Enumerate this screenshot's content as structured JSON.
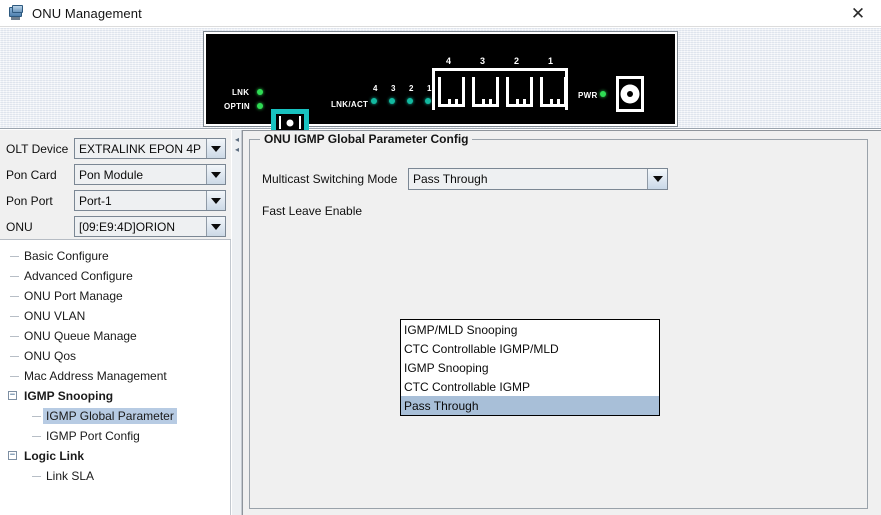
{
  "window": {
    "title": "ONU Management",
    "icon": "computer-monitor-icon",
    "close_label": "✕"
  },
  "device_panel": {
    "lnk_label": "LNK",
    "optin_label": "OPTIN",
    "lnkact_label": "LNK/ACT",
    "pwr_label": "PWR",
    "lnkact_numbers": [
      "4",
      "3",
      "2",
      "1"
    ],
    "port_numbers": [
      "4",
      "3",
      "2",
      "1"
    ],
    "led_green": "#2fdc54",
    "led_teal": "#13b9a0",
    "connector_color": "#18c2c0"
  },
  "selectors": [
    {
      "label": "OLT Device",
      "value": "EXTRALINK EPON 4P"
    },
    {
      "label": "Pon Card",
      "value": "Pon Module"
    },
    {
      "label": "Pon Port",
      "value": "Port-1"
    },
    {
      "label": "ONU",
      "value": "[09:E9:4D]ORION"
    }
  ],
  "tree": {
    "items": [
      {
        "label": "Basic Configure",
        "level": 1,
        "bold": false,
        "selected": false,
        "expander": null
      },
      {
        "label": "Advanced Configure",
        "level": 1,
        "bold": false,
        "selected": false,
        "expander": null
      },
      {
        "label": "ONU Port Manage",
        "level": 1,
        "bold": false,
        "selected": false,
        "expander": null
      },
      {
        "label": "ONU VLAN",
        "level": 1,
        "bold": false,
        "selected": false,
        "expander": null
      },
      {
        "label": "ONU Queue Manage",
        "level": 1,
        "bold": false,
        "selected": false,
        "expander": null
      },
      {
        "label": "ONU Qos",
        "level": 1,
        "bold": false,
        "selected": false,
        "expander": null
      },
      {
        "label": "Mac Address Management",
        "level": 1,
        "bold": false,
        "selected": false,
        "expander": null
      },
      {
        "label": "IGMP Snooping",
        "level": 1,
        "bold": true,
        "selected": false,
        "expander": "−"
      },
      {
        "label": "IGMP Global Parameter",
        "level": 2,
        "bold": false,
        "selected": true,
        "expander": null
      },
      {
        "label": "IGMP Port Config",
        "level": 2,
        "bold": false,
        "selected": false,
        "expander": null
      },
      {
        "label": "Logic Link",
        "level": 1,
        "bold": true,
        "selected": false,
        "expander": "−"
      },
      {
        "label": "Link SLA",
        "level": 2,
        "bold": false,
        "selected": false,
        "expander": null
      }
    ],
    "selection_color": "#b7cbe3"
  },
  "splitter": {
    "collapse_icon": "◂"
  },
  "content": {
    "group_title": "ONU IGMP Global Parameter Config",
    "rows": [
      {
        "label": "Multicast Switching Mode"
      },
      {
        "label": "Fast Leave Enable"
      }
    ],
    "multicast_mode_value": "Pass Through"
  },
  "dropdown": {
    "open": true,
    "options": [
      "IGMP/MLD Snooping",
      "CTC Controllable IGMP/MLD",
      "IGMP Snooping",
      "CTC Controllable IGMP",
      "Pass Through"
    ],
    "selected_index": 4,
    "highlight_color": "#a8bfd8"
  }
}
